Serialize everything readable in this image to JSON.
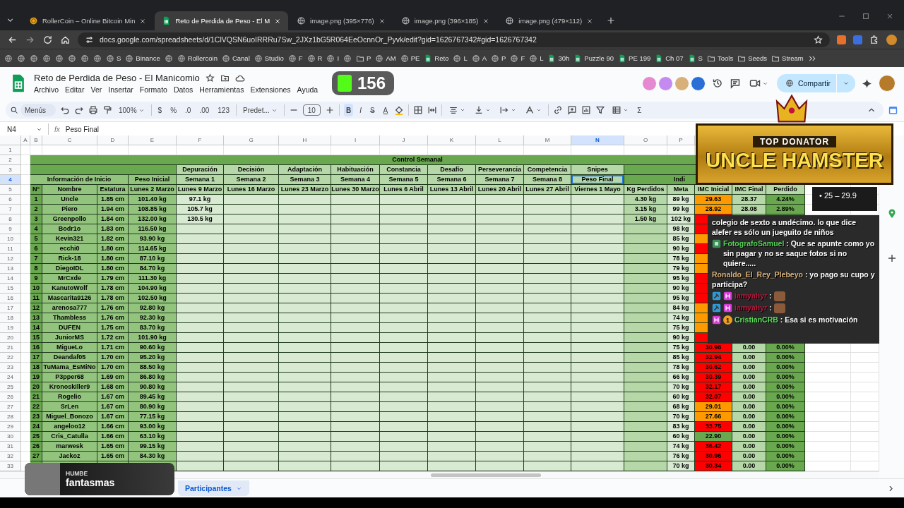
{
  "browser": {
    "tabs": [
      {
        "title": "RollerCoin – Online Bitcoin Min",
        "kind": "coin",
        "selected": false
      },
      {
        "title": "Reto de Perdida de Peso - El M",
        "kind": "sheets",
        "selected": true
      },
      {
        "title": "image.png (395×776)",
        "kind": "globe",
        "selected": false
      },
      {
        "title": "image.png (396×185)",
        "kind": "globe",
        "selected": false
      },
      {
        "title": "image.png (479×112)",
        "kind": "globe",
        "selected": false
      }
    ],
    "url": "docs.google.com/spreadsheets/d/1ClVQSN6uoIRRRu7Sw_2JXz1bG5R064EeOcnnOr_Pyvk/edit?gid=1626767342#gid=1626767342",
    "bookmarks": [
      {
        "kind": "site"
      },
      {
        "kind": "site"
      },
      {
        "kind": "site"
      },
      {
        "kind": "site"
      },
      {
        "kind": "site"
      },
      {
        "kind": "site"
      },
      {
        "kind": "site"
      },
      {
        "kind": "site"
      },
      {
        "kind": "site",
        "label": "S"
      },
      {
        "kind": "site",
        "label": "Binance"
      },
      {
        "kind": "site"
      },
      {
        "kind": "site",
        "label": "Rollercoin"
      },
      {
        "kind": "site",
        "label": "Canal"
      },
      {
        "kind": "site",
        "label": "Studio"
      },
      {
        "kind": "site",
        "label": "F"
      },
      {
        "kind": "site",
        "label": "R"
      },
      {
        "kind": "site",
        "label": "I"
      },
      {
        "kind": "site"
      },
      {
        "kind": "folder",
        "label": "P"
      },
      {
        "kind": "site",
        "label": "AM"
      },
      {
        "kind": "site",
        "label": "PE"
      },
      {
        "kind": "sheet",
        "label": "Reto"
      },
      {
        "kind": "site",
        "label": "L"
      },
      {
        "kind": "site",
        "label": "A"
      },
      {
        "kind": "site",
        "label": "P"
      },
      {
        "kind": "site",
        "label": "F"
      },
      {
        "kind": "site",
        "label": "L"
      },
      {
        "kind": "sheet",
        "label": "30h"
      },
      {
        "kind": "sheet",
        "label": "Puzzle 90"
      },
      {
        "kind": "sheet",
        "label": "PE 199"
      },
      {
        "kind": "sheet",
        "label": "Ch 07"
      },
      {
        "kind": "sheet",
        "label": "S"
      },
      {
        "kind": "folder",
        "label": "Tools"
      },
      {
        "kind": "folder",
        "label": "Seeds"
      },
      {
        "kind": "folder",
        "label": "Stream"
      }
    ]
  },
  "doc": {
    "title": "Reto de Perdida de Peso - El Manicomio",
    "menus": [
      "Archivo",
      "Editar",
      "Ver",
      "Insertar",
      "Formato",
      "Datos",
      "Herramientas",
      "Extensiones",
      "Ayuda"
    ],
    "collaborators": [
      {
        "color": "#e58ad0"
      },
      {
        "color": "#c58af0"
      },
      {
        "color": "#d8b07a"
      },
      {
        "color": "#2a6fd6"
      }
    ],
    "share_label": "Compartir"
  },
  "toolbar": {
    "search_placeholder": "Menús",
    "zoom": "100%",
    "currency": "$",
    "percent": "%",
    "decrease_decimals": ".0",
    "increase_decimals": ".00",
    "number_format": "123",
    "font": "Predet...",
    "font_size": "10",
    "text_styles": [
      {
        "label": "B",
        "on": true
      },
      {
        "label": "I",
        "on": false
      },
      {
        "label": "S",
        "on": false
      },
      {
        "label": "A",
        "on": false
      }
    ],
    "functions": "Σ"
  },
  "formula_bar": {
    "cell": "N4",
    "label": "fx",
    "content": "Peso Final"
  },
  "sheet": {
    "column_headers": [
      {
        "label": "A",
        "selected": false
      },
      {
        "label": "B",
        "selected": false
      },
      {
        "label": "C",
        "selected": false
      },
      {
        "label": "D",
        "selected": false
      },
      {
        "label": "E",
        "selected": false
      },
      {
        "label": "F",
        "selected": false
      },
      {
        "label": "G",
        "selected": false
      },
      {
        "label": "H",
        "selected": false
      },
      {
        "label": "I",
        "selected": false
      },
      {
        "label": "J",
        "selected": false
      },
      {
        "label": "K",
        "selected": false
      },
      {
        "label": "L",
        "selected": false
      },
      {
        "label": "M",
        "selected": false
      },
      {
        "label": "N",
        "selected": true
      },
      {
        "label": "O",
        "selected": false
      },
      {
        "label": "P",
        "selected": false
      }
    ],
    "row_headers": [
      {
        "label": "1",
        "selected": false
      },
      {
        "label": "2",
        "selected": false
      },
      {
        "label": "3",
        "selected": false
      },
      {
        "label": "4",
        "selected": true
      },
      {
        "label": "5",
        "selected": false
      },
      {
        "label": "6",
        "selected": false
      },
      {
        "label": "7",
        "selected": false
      },
      {
        "label": "8",
        "selected": false
      },
      {
        "label": "9",
        "selected": false
      },
      {
        "label": "10",
        "selected": false
      },
      {
        "label": "11",
        "selected": false
      },
      {
        "label": "12",
        "selected": false
      },
      {
        "label": "13",
        "selected": false
      },
      {
        "label": "14",
        "selected": false
      },
      {
        "label": "15",
        "selected": false
      },
      {
        "label": "16",
        "selected": false
      },
      {
        "label": "17",
        "selected": false
      },
      {
        "label": "18",
        "selected": false
      },
      {
        "label": "19",
        "selected": false
      },
      {
        "label": "20",
        "selected": false
      },
      {
        "label": "21",
        "selected": false
      },
      {
        "label": "22",
        "selected": false
      },
      {
        "label": "23",
        "selected": false
      },
      {
        "label": "24",
        "selected": false
      },
      {
        "label": "25",
        "selected": false
      },
      {
        "label": "26",
        "selected": false
      },
      {
        "label": "27",
        "selected": false
      },
      {
        "label": "28",
        "selected": false
      },
      {
        "label": "29",
        "selected": false
      },
      {
        "label": "30",
        "selected": false
      },
      {
        "label": "31",
        "selected": false
      },
      {
        "label": "32",
        "selected": false
      },
      {
        "label": "33",
        "selected": false
      }
    ],
    "title": "Control Semanal",
    "phases": [
      "Depuración",
      "Decisión",
      "Adaptación",
      "Habituación",
      "Constancia",
      "Desafío",
      "Perseverancia",
      "Competencia",
      "Snipes"
    ],
    "info_label": "Información de Inicio",
    "initial_weight_label": "Peso Inicial",
    "weeks": [
      {
        "label": "Semana 1",
        "selected": false
      },
      {
        "label": "Semana 2",
        "selected": false
      },
      {
        "label": "Semana 3",
        "selected": false
      },
      {
        "label": "Semana 4",
        "selected": false
      },
      {
        "label": "Semana 5",
        "selected": false
      },
      {
        "label": "Semana 6",
        "selected": false
      },
      {
        "label": "Semana 7",
        "selected": false
      },
      {
        "label": "Semana 8",
        "selected": false
      },
      {
        "label": "Peso Final",
        "selected": true
      }
    ],
    "indicators_label": "Indi",
    "columns": [
      "N°",
      "Nombre",
      "Estatura",
      "Lunes 2 Marzo",
      "Lunes 9 Marzo",
      "Lunes 16 Marzo",
      "Lunes 23 Marzo",
      "Lunes 30 Marzo",
      "Lunes 6 Abril",
      "Lunes 13 Abril",
      "Lunes 20 Abril",
      "Lunes 27 Abril",
      "Viernes 1 Mayo",
      "Kg Perdidos",
      "Meta",
      "IMC Inicial",
      "IMC Final",
      "Perdido"
    ],
    "rows": [
      {
        "n": "1",
        "name": "Uncle",
        "height": "1.85 cm",
        "weight": "101.40 kg",
        "week_1": "97.1 kg",
        "lost": "4.30 kg",
        "goal": "89 kg",
        "color": "#ff9900",
        "imc_initial": "29.63",
        "imc_final": "28.37",
        "lost_pct": "4.24%"
      },
      {
        "n": "2",
        "name": "Piero",
        "height": "1.94 cm",
        "weight": "108.85 kg",
        "week_1": "105.7 kg",
        "lost": "3.15 kg",
        "goal": "99 kg",
        "color": "#ff9900",
        "imc_initial": "28.92",
        "imc_final": "28.08",
        "lost_pct": "2.89%"
      },
      {
        "n": "3",
        "name": "Greenpollo",
        "height": "1.84 cm",
        "weight": "132.00 kg",
        "week_1": "130.5 kg",
        "lost": "1.50 kg",
        "goal": "102 kg",
        "color": "#ff0000"
      },
      {
        "n": "4",
        "name": "Bodr1o",
        "height": "1.83 cm",
        "weight": "116.50 kg",
        "goal": "98 kg",
        "color": "#ff0000"
      },
      {
        "n": "5",
        "name": "Kevin321",
        "height": "1.82 cm",
        "weight": "93.90 kg",
        "goal": "85 kg",
        "color": "#ff9900"
      },
      {
        "n": "6",
        "name": "ecchi0",
        "height": "1.80 cm",
        "weight": "114.65 kg",
        "goal": "90 kg",
        "color": "#ff0000"
      },
      {
        "n": "7",
        "name": "Rick-18",
        "height": "1.80 cm",
        "weight": "87.10 kg",
        "goal": "78 kg",
        "color": "#ff9900"
      },
      {
        "n": "8",
        "name": "DiegoIDL",
        "height": "1.80 cm",
        "weight": "84.70 kg",
        "goal": "79 kg",
        "color": "#ff9900"
      },
      {
        "n": "9",
        "name": "MrCxde",
        "height": "1.79 cm",
        "weight": "111.30 kg",
        "goal": "95 kg",
        "color": "#ff0000"
      },
      {
        "n": "10",
        "name": "KanutoWolf",
        "height": "1.78 cm",
        "weight": "104.90 kg",
        "goal": "90 kg",
        "color": "#ff0000"
      },
      {
        "n": "11",
        "name": "Mascarita9126",
        "height": "1.78 cm",
        "weight": "102.50 kg",
        "goal": "95 kg",
        "color": "#ff0000"
      },
      {
        "n": "12",
        "name": "arenosa777",
        "height": "1.76 cm",
        "weight": "92.80 kg",
        "goal": "84 kg",
        "color": "#ff9900"
      },
      {
        "n": "13",
        "name": "Thambless",
        "height": "1.76 cm",
        "weight": "92.30 kg",
        "goal": "74 kg",
        "color": "#ff9900"
      },
      {
        "n": "14",
        "name": "DUFEN",
        "height": "1.75 cm",
        "weight": "83.70 kg",
        "goal": "75 kg",
        "color": "#ff9900"
      },
      {
        "n": "15",
        "name": "JuniorMS",
        "height": "1.72 cm",
        "weight": "101.90 kg",
        "goal": "90 kg",
        "color": "#ff0000"
      },
      {
        "n": "16",
        "name": "MigueLo",
        "height": "1.71 cm",
        "weight": "90.60 kg",
        "goal": "75 kg",
        "color": "#ff0000",
        "imc_initial": "30.98",
        "imc_final": "0.00",
        "lost_pct": "0.00%"
      },
      {
        "n": "17",
        "name": "Deandaf05",
        "height": "1.70 cm",
        "weight": "95.20 kg",
        "goal": "85 kg",
        "color": "#ff0000",
        "imc_initial": "32.94",
        "imc_final": "0.00",
        "lost_pct": "0.00%"
      },
      {
        "n": "18",
        "name": "TuMama_EsMiNo",
        "height": "1.70 cm",
        "weight": "88.50 kg",
        "goal": "78 kg",
        "color": "#ff0000",
        "imc_initial": "30.62",
        "imc_final": "0.00",
        "lost_pct": "0.00%"
      },
      {
        "n": "19",
        "name": "P3pper68",
        "height": "1.69 cm",
        "weight": "86.80 kg",
        "goal": "66 kg",
        "color": "#ff0000",
        "imc_initial": "30.39",
        "imc_final": "0.00",
        "lost_pct": "0.00%"
      },
      {
        "n": "20",
        "name": "Kronoskiller9",
        "height": "1.68 cm",
        "weight": "90.80 kg",
        "goal": "70 kg",
        "color": "#ff0000",
        "imc_initial": "32.17",
        "imc_final": "0.00",
        "lost_pct": "0.00%"
      },
      {
        "n": "21",
        "name": "Rogelio",
        "height": "1.67 cm",
        "weight": "89.45 kg",
        "goal": "60 kg",
        "color": "#ff0000",
        "imc_initial": "32.07",
        "imc_final": "0.00",
        "lost_pct": "0.00%"
      },
      {
        "n": "22",
        "name": "SrLen",
        "height": "1.67 cm",
        "weight": "80.90 kg",
        "goal": "68 kg",
        "color": "#ff9900",
        "imc_initial": "29.01",
        "imc_final": "0.00",
        "lost_pct": "0.00%"
      },
      {
        "n": "23",
        "name": "Miguel_Bonozo",
        "height": "1.67 cm",
        "weight": "77.15 kg",
        "goal": "70 kg",
        "color": "#ff9900",
        "imc_initial": "27.66",
        "imc_final": "0.00",
        "lost_pct": "0.00%"
      },
      {
        "n": "24",
        "name": "angeloo12",
        "height": "1.66 cm",
        "weight": "93.00 kg",
        "goal": "83 kg",
        "color": "#ff0000",
        "imc_initial": "33.75",
        "imc_final": "0.00",
        "lost_pct": "0.00%"
      },
      {
        "n": "25",
        "name": "Cris_Catulla",
        "height": "1.66 cm",
        "weight": "63.10 kg",
        "goal": "60 kg",
        "color": "#6aa84f",
        "imc_initial": "22.90",
        "imc_final": "0.00",
        "lost_pct": "0.00%"
      },
      {
        "n": "26",
        "name": "marwesk",
        "height": "1.65 cm",
        "weight": "99.15 kg",
        "goal": "74 kg",
        "color": "#ff0000",
        "imc_initial": "36.42",
        "imc_final": "0.00",
        "lost_pct": "0.00%"
      },
      {
        "n": "27",
        "name": "Jackoz",
        "height": "1.65 cm",
        "weight": "84.30 kg",
        "goal": "76 kg",
        "color": "#ff0000",
        "imc_initial": "30.96",
        "imc_final": "0.00",
        "lost_pct": "0.00%"
      },
      {
        "goal": "70 kg",
        "color": "#ff0000",
        "imc_initial": "30.34",
        "imc_final": "0.00",
        "lost_pct": "0.00%"
      }
    ]
  },
  "sheet_tabs": [
    {
      "label": "Participantes",
      "selected": true
    }
  ],
  "overlay": {
    "counter": "156",
    "banner": {
      "kicker": "TOP DONATOR",
      "name": "UNCLE HAMSTER"
    },
    "legend": "• 25 – 29.9",
    "chat": [
      {
        "kind": "continuation",
        "text": "colegio de sexto a undécimo. lo que dice alefer es sólo un jueguito de niños"
      },
      {
        "kind": "text",
        "badges": [
          {
            "kind": "pixel"
          }
        ],
        "user": "FotografoSamuel",
        "color": "#55d455",
        "text": ": Que se apunte como yo sin pagar y no se saque fotos si no quiere....."
      },
      {
        "kind": "text",
        "user": "Ronaldo_El_Rey_Plebeyo",
        "color": "#d9b27a",
        "text": ": yo pago su cupo y participa?"
      },
      {
        "kind": "emote",
        "badges": [
          {
            "kind": "mod"
          },
          {
            "kind": "sub"
          }
        ],
        "user": "iamyahyr",
        "color": "#c0143c",
        "text": ":"
      },
      {
        "kind": "emote",
        "badges": [
          {
            "kind": "mod"
          },
          {
            "kind": "sub"
          }
        ],
        "user": "iamyahyr",
        "color": "#c0143c",
        "text": ":"
      },
      {
        "kind": "text",
        "badges": [
          {
            "kind": "sub"
          },
          {
            "kind": "count",
            "label": "1"
          }
        ],
        "user": "CristianCRB",
        "color": "#5de05d",
        "text": ": Esa si es motivación"
      }
    ],
    "music": {
      "artist": "HUMBE",
      "song": "fantasmas"
    }
  }
}
